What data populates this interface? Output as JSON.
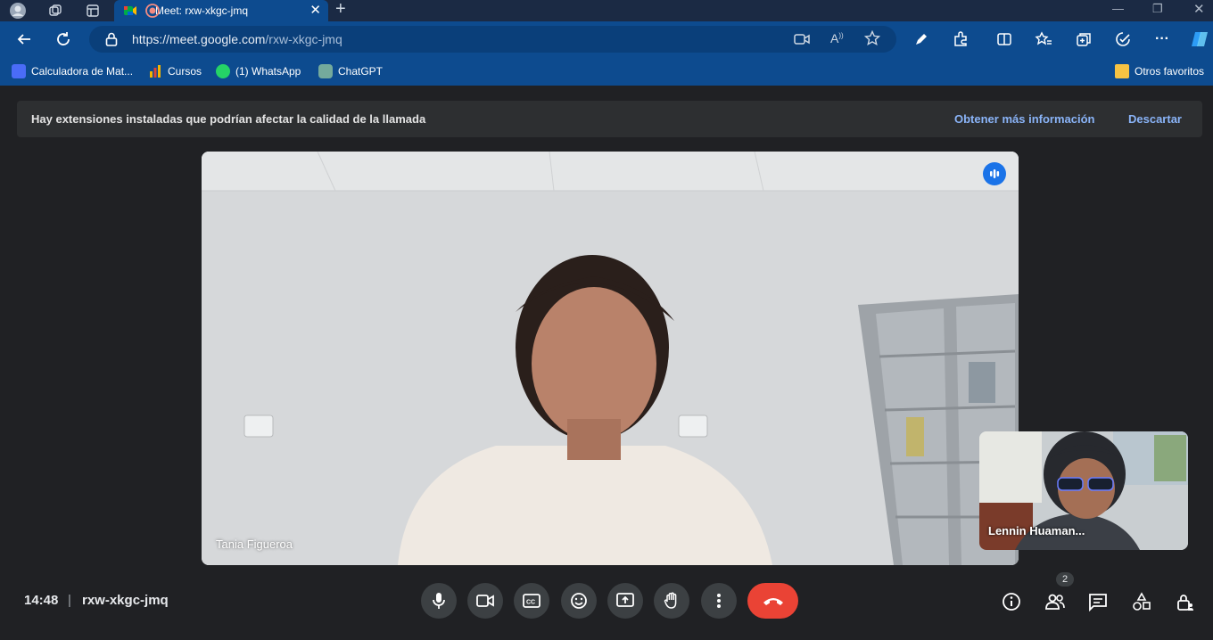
{
  "browser": {
    "tab_title": "Meet: rxw-xkgc-jmq",
    "url_host": "https://meet.google.com",
    "url_path": "/rxw-xkgc-jmq"
  },
  "bookmarks": [
    {
      "label": "Calculadora de Mat...",
      "icon": "calculator-icon"
    },
    {
      "label": "Cursos",
      "icon": "bar-chart-icon"
    },
    {
      "label": "(1) WhatsApp",
      "icon": "whatsapp-icon"
    },
    {
      "label": "ChatGPT",
      "icon": "chatgpt-icon"
    }
  ],
  "other_favorites": "Otros favoritos",
  "banner": {
    "message": "Hay extensiones instaladas que podrían afectar la calidad de la llamada",
    "more_info": "Obtener más información",
    "dismiss": "Descartar"
  },
  "main_participant": "Tania Figueroa",
  "self_participant": "Lennin Huaman...",
  "meeting": {
    "time": "14:48",
    "separator": "|",
    "code": "rxw-xkgc-jmq"
  },
  "participants_count": "2",
  "colors": {
    "accent": "#1a73e8",
    "end_call": "#ea4335",
    "link": "#8ab4f8",
    "browser_chrome": "#0d4b8f"
  }
}
